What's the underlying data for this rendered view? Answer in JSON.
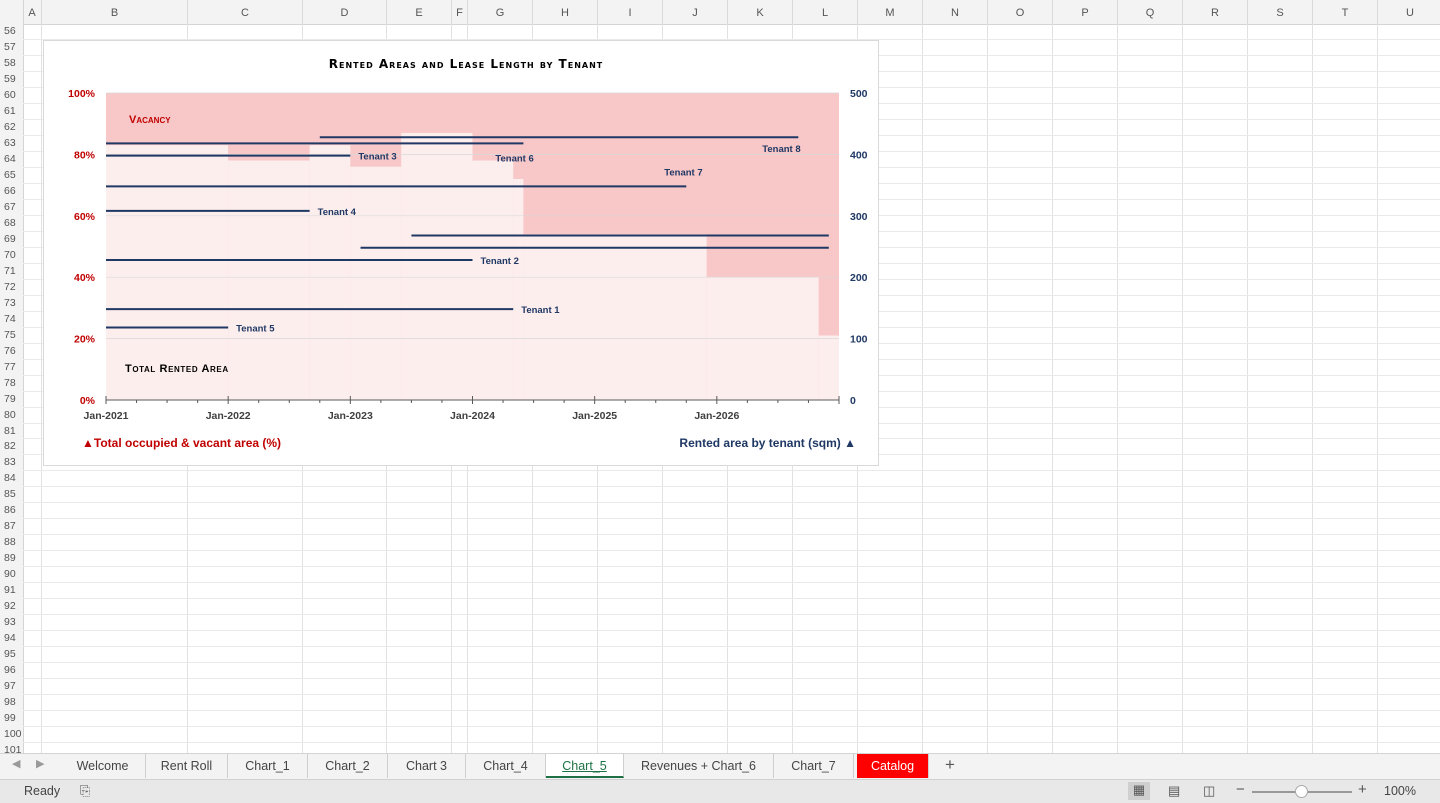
{
  "columns": [
    "A",
    "B",
    "C",
    "D",
    "E",
    "F",
    "G",
    "H",
    "I",
    "J",
    "K",
    "L",
    "M",
    "N",
    "O",
    "P",
    "Q",
    "R",
    "S",
    "T",
    "U"
  ],
  "rows": [
    "56",
    "57",
    "58",
    "59",
    "60",
    "61",
    "62",
    "63",
    "64",
    "65",
    "66",
    "67",
    "68",
    "69",
    "70",
    "71",
    "72",
    "73",
    "74",
    "75",
    "76",
    "77",
    "78",
    "79",
    "80",
    "81",
    "82",
    "83",
    "84",
    "85",
    "86",
    "87",
    "88",
    "89",
    "90",
    "91",
    "92",
    "93",
    "94",
    "95",
    "96",
    "97",
    "98",
    "99",
    "100",
    "101"
  ],
  "chart": {
    "title": "Rented Areas and Lease Length by Tenant",
    "vacancy_label": "Vacancy",
    "total_label": "Total Rented Area",
    "left_axis_caption": "▲Total occupied & vacant area (%)",
    "right_axis_caption": "Rented area by tenant (sqm) ▲",
    "left_ticks": [
      "0%",
      "20%",
      "40%",
      "60%",
      "80%",
      "100%"
    ],
    "right_ticks": [
      "0",
      "100",
      "200",
      "300",
      "400",
      "500"
    ],
    "x_ticks": [
      "Jan-2021",
      "Jan-2022",
      "Jan-2023",
      "Jan-2024",
      "Jan-2025",
      "Jan-2026"
    ],
    "colors": {
      "vacancy": "#f8c7c8",
      "occupied": "#fdeeee",
      "tenant_line": "#1f3864",
      "left_axis": "#c00000",
      "right_axis": "#1f3864"
    }
  },
  "chart_data": {
    "type": "line",
    "title": "Rented Areas and Lease Length by Tenant",
    "x_range": [
      "2021-01",
      "2027-01"
    ],
    "y_left": {
      "label": "Total occupied & vacant area (%)",
      "range": [
        0,
        100
      ]
    },
    "y_right": {
      "label": "Rented area by tenant (sqm)",
      "range": [
        0,
        500
      ]
    },
    "occupancy_pct_steps": [
      {
        "from": "2021-01",
        "to": "2022-01",
        "occupied_pct": 83
      },
      {
        "from": "2022-01",
        "to": "2022-09",
        "occupied_pct": 78
      },
      {
        "from": "2022-09",
        "to": "2023-01",
        "occupied_pct": 83
      },
      {
        "from": "2023-01",
        "to": "2023-06",
        "occupied_pct": 76
      },
      {
        "from": "2023-06",
        "to": "2024-01",
        "occupied_pct": 87
      },
      {
        "from": "2024-01",
        "to": "2024-05",
        "occupied_pct": 78
      },
      {
        "from": "2024-05",
        "to": "2024-06",
        "occupied_pct": 72
      },
      {
        "from": "2024-06",
        "to": "2025-12",
        "occupied_pct": 54
      },
      {
        "from": "2025-12",
        "to": "2026-11",
        "occupied_pct": 40
      },
      {
        "from": "2026-11",
        "to": "2027-01",
        "occupied_pct": 21
      }
    ],
    "series": [
      {
        "name": "Tenant 1",
        "area_sqm": 148,
        "start": "2021-01",
        "end": "2024-05"
      },
      {
        "name": "Tenant 2",
        "area_sqm": 228,
        "start": "2021-01",
        "end": "2024-01"
      },
      {
        "name": "Tenant 3",
        "area_sqm": 398,
        "start": "2021-01",
        "end": "2023-01"
      },
      {
        "name": "Tenant 4",
        "area_sqm": 308,
        "start": "2021-01",
        "end": "2022-09"
      },
      {
        "name": "Tenant 5",
        "area_sqm": 118,
        "start": "2021-01",
        "end": "2022-01"
      },
      {
        "name": "Tenant 6",
        "area_sqm": 418,
        "start": "2021-01",
        "end": "2024-06"
      },
      {
        "name": "Tenant 7",
        "area_sqm": 348,
        "start": "2021-01",
        "end": "2025-10"
      },
      {
        "name": "Tenant 8",
        "area_sqm": 428,
        "start": "2022-10",
        "end": "2026-09"
      },
      {
        "area_sqm": 268,
        "start": "2023-07",
        "end": "2026-12"
      },
      {
        "area_sqm": 248,
        "start": "2023-02",
        "end": "2026-12"
      }
    ]
  },
  "tabs": [
    {
      "label": "Welcome"
    },
    {
      "label": "Rent Roll"
    },
    {
      "label": "Chart_1"
    },
    {
      "label": "Chart_2"
    },
    {
      "label": "Chart 3"
    },
    {
      "label": "Chart_4"
    },
    {
      "label": "Chart_5"
    },
    {
      "label": "Revenues + Chart_6"
    },
    {
      "label": "Chart_7"
    },
    {
      "label": "Catalog"
    }
  ],
  "active_tab": "Chart_5",
  "status": {
    "text": "Ready",
    "zoom": "100%"
  }
}
